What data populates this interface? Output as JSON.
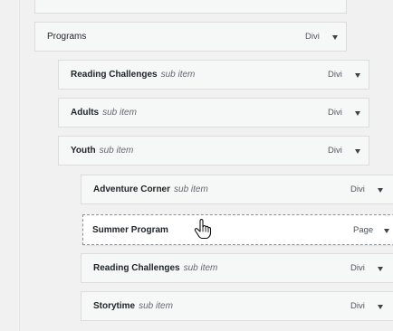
{
  "menu": {
    "items": [
      {
        "title": "Programs",
        "sub": "",
        "type": "Divi"
      },
      {
        "title": "Reading Challenges",
        "sub": "sub item",
        "type": "Divi"
      },
      {
        "title": "Adults",
        "sub": "sub item",
        "type": "Divi"
      },
      {
        "title": "Youth",
        "sub": "sub item",
        "type": "Divi"
      },
      {
        "title": "Adventure Corner",
        "sub": "sub item",
        "type": "Divi"
      },
      {
        "title": "Summer Program",
        "sub": "",
        "type": "Page"
      },
      {
        "title": "Reading Challenges",
        "sub": "sub item",
        "type": "Divi"
      },
      {
        "title": "Storytime",
        "sub": "sub item",
        "type": "Divi"
      }
    ]
  },
  "icons": {
    "caret": "chevron-down-icon",
    "cursor": "hand-pointer-icon"
  },
  "colors": {
    "item_bg": "#f6f7f7",
    "item_border": "#dcdcde",
    "panel_bg": "#f1f1f1"
  }
}
